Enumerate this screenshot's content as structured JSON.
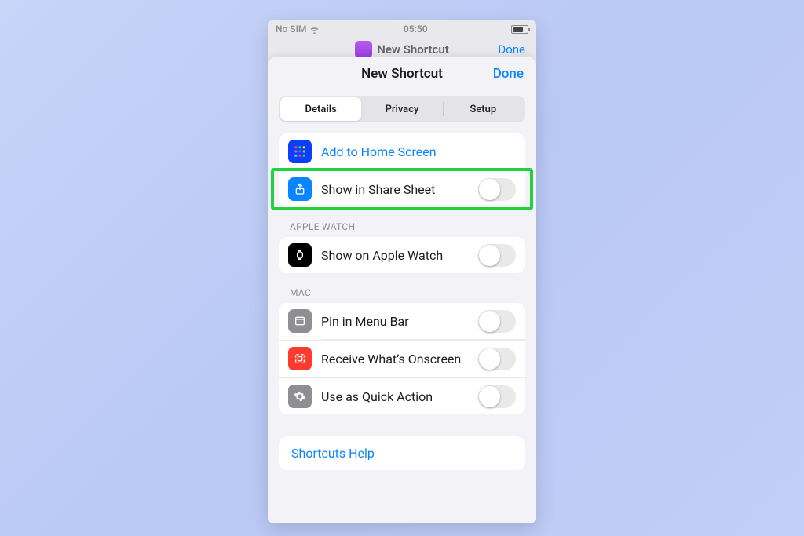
{
  "status": {
    "carrier": "No SIM",
    "time": "05:50"
  },
  "behind": {
    "title": "New Shortcut",
    "done": "Done"
  },
  "sheet": {
    "title": "New Shortcut",
    "done": "Done"
  },
  "tabs": {
    "details": "Details",
    "privacy": "Privacy",
    "setup": "Setup"
  },
  "rows": {
    "add_home": "Add to Home Screen",
    "share_sheet": "Show in Share Sheet",
    "apple_watch": "Show on Apple Watch",
    "pin_menu": "Pin in Menu Bar",
    "receive": "Receive What’s Onscreen",
    "quick_action": "Use as Quick Action"
  },
  "sections": {
    "apple_watch": "APPLE WATCH",
    "mac": "MAC"
  },
  "help": "Shortcuts Help",
  "colors": {
    "link": "#0a84ff",
    "highlight": "#1fd23e",
    "icon_blue": "#0a84ff",
    "icon_red": "#ff3b30",
    "icon_gray": "#8e8e93",
    "icon_black": "#000000"
  }
}
